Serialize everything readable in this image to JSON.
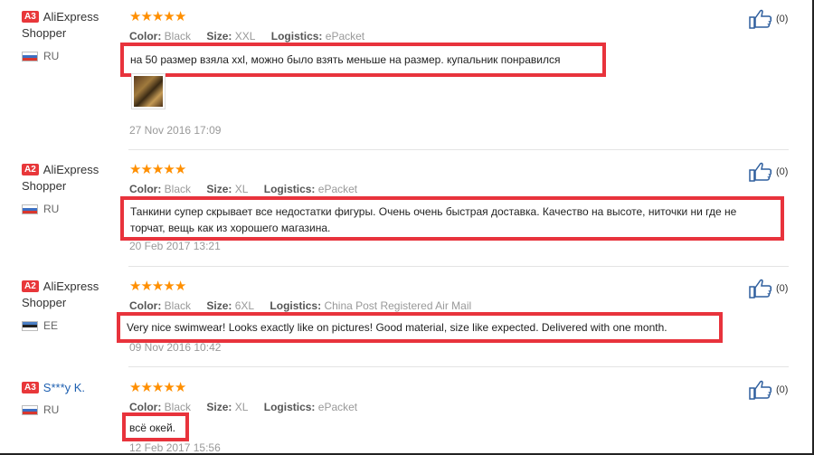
{
  "reviews": [
    {
      "level": "A3",
      "name": "AliExpress Shopper",
      "country": "RU",
      "color_label": "Color:",
      "color": "Black",
      "size_label": "Size:",
      "size": "XXL",
      "logistics_label": "Logistics:",
      "logistics": "ePacket",
      "text": "на 50 размер взяла xxl, можно было взять меньше на размер. купальник понравился",
      "date": "27 Nov 2016 17:09",
      "likes": "(0)",
      "rating": 5
    },
    {
      "level": "A2",
      "name": "AliExpress Shopper",
      "country": "RU",
      "color_label": "Color:",
      "color": "Black",
      "size_label": "Size:",
      "size": "XL",
      "logistics_label": "Logistics:",
      "logistics": "ePacket",
      "text": "Танкини супер скрывает все недостатки фигуры. Очень очень быстрая доставка. Качество на высоте, ниточки ни где не торчат, вещь как из хорошего магазина.",
      "date": "20 Feb 2017 13:21",
      "likes": "(0)",
      "rating": 5
    },
    {
      "level": "A2",
      "name": "AliExpress Shopper",
      "country": "EE",
      "color_label": "Color:",
      "color": "Black",
      "size_label": "Size:",
      "size": "6XL",
      "logistics_label": "Logistics:",
      "logistics": "China Post Registered Air Mail",
      "text": "Very nice swimwear! Looks exactly like on pictures! Good material, size like expected. Delivered with one month.",
      "date": "09 Nov 2016 10:42",
      "likes": "(0)",
      "rating": 5
    },
    {
      "level": "A3",
      "name": "S***y K.",
      "country": "RU",
      "color_label": "Color:",
      "color": "Black",
      "size_label": "Size:",
      "size": "XL",
      "logistics_label": "Logistics:",
      "logistics": "ePacket",
      "text": "всё окей.",
      "date": "12 Feb 2017 15:56",
      "likes": "(0)",
      "rating": 5
    }
  ],
  "colors": {
    "star": "#ff8f00",
    "highlight_box": "#e8333c",
    "level_badge": "#e8373a",
    "link": "#1d5fb0"
  },
  "icons": {
    "star": "star-icon",
    "like": "thumbs-up-icon",
    "flag_ru": "flag-ru-icon",
    "flag_ee": "flag-ee-icon"
  }
}
